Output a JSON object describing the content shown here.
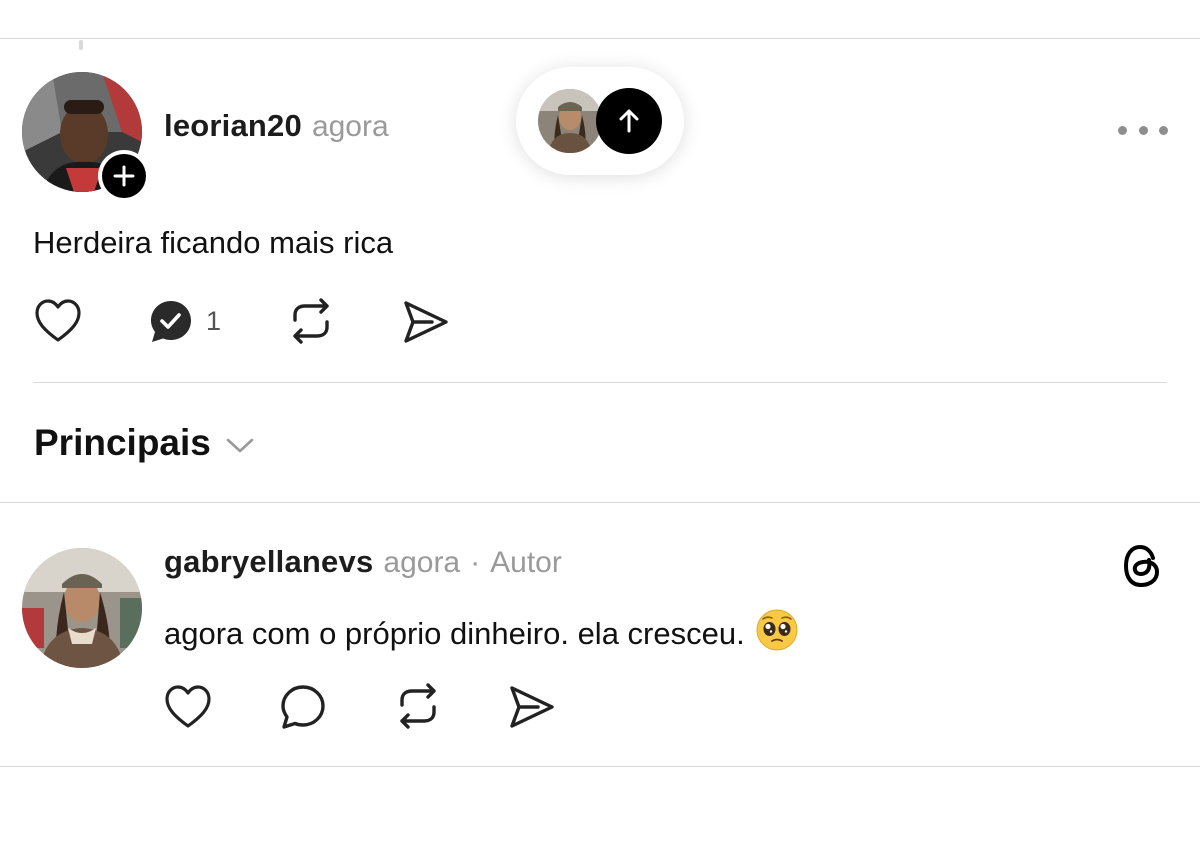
{
  "post": {
    "username": "leorian20",
    "time": "agora",
    "text": "Herdeira ficando mais rica",
    "reply_count": "1"
  },
  "new_posts_pill": {
    "icon": "arrow-up-icon"
  },
  "replies_section": {
    "title": "Principais"
  },
  "reply": {
    "username": "gabryellanevs",
    "time": "agora",
    "separator": "·",
    "author_badge": "Autor",
    "text": "agora com o próprio dinheiro. ela cresceu.",
    "emoji": "pleading-face-emoji"
  },
  "colors": {
    "background": "#ffffff",
    "text": "#111111",
    "muted": "#9a9a9a",
    "divider": "#d9d9d9",
    "accent": "#000000"
  }
}
